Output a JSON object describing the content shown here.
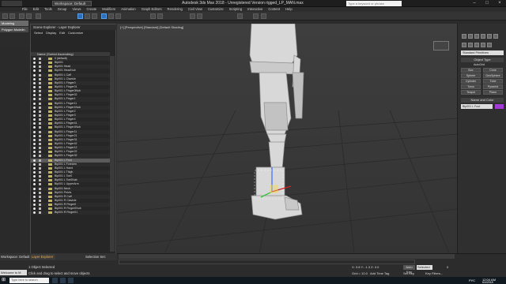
{
  "titlebar": {
    "title": "Autodesk 3ds Max 2018 - Unregistered Version   rigged_LP_MAN.max",
    "workspace_label": "Workspace: Default",
    "search_placeholder": "Type a keyword or phrase"
  },
  "menubar": {
    "items": [
      "File",
      "Edit",
      "Tools",
      "Group",
      "Views",
      "Create",
      "Modifiers",
      "Animation",
      "Graph Editors",
      "Rendering",
      "Civil View",
      "Customize",
      "Scripting",
      "Interactive",
      "Content",
      "Help"
    ]
  },
  "left_ribbon": {
    "tabs": [
      "Modeling",
      "Polygon Modelin"
    ]
  },
  "scene_explorer": {
    "title": "Scene Explorer - Layer Explorer",
    "menu": [
      "Select",
      "Display",
      "Edit",
      "Customize"
    ],
    "column_header": "Name (Sorted Ascending)",
    "rows": [
      "0 (default)",
      "Bip001",
      "Bip001 Head",
      "Bip001 HeadNub",
      "Bip001 L Calf",
      "Bip001 L Clavicle",
      "Bip001 L Finger0",
      "Bip001 L Finger01",
      "Bip001 L Finger0Nub",
      "Bip001 L Finger02",
      "Bip001 L Finger1",
      "Bip001 L Finger11",
      "Bip001 L Finger1Nub",
      "Bip001 L Finger2",
      "Bip001 L Finger3",
      "Bip001 L Finger4",
      "Bip001 L Finger41",
      "Bip001 L Finger4Nub",
      "Bip001 L Finger11",
      "Bip001 L Finger21",
      "Bip001 L Finger31",
      "Bip001 L Finger42",
      "Bip001 L Finger12",
      "Bip001 L Finger22",
      "Bip001 L Finger32",
      "Bip001 L Foot",
      "Bip001 L Forearm",
      "Bip001 L Hand",
      "Bip001 L Thigh",
      "Bip001 L Toe0",
      "Bip001 L Toe0Nub",
      "Bip001 L UpperArm",
      "Bip001 Neck",
      "Bip001 Pelvis",
      "Bip001 R Calf",
      "Bip001 R Clavicle",
      "Bip001 R Finger0",
      "Bip001 R Finger0Nub",
      "Bip001 R Finger01"
    ],
    "selected_index": 25
  },
  "viewport": {
    "label": "[+] [Perspective] [Standard] [Default Shading]"
  },
  "command_panel": {
    "dropdown": "Standard Primitives",
    "rollout_object_type": "Object Type",
    "autogrid": "AutoGrid",
    "buttons": [
      "Box",
      "Cone",
      "Sphere",
      "GeoSphere",
      "Cylinder",
      "Tube",
      "Torus",
      "Pyramid",
      "Teapot",
      "Plane"
    ],
    "rollout_name_color": "Name and Color",
    "name_value": "Bip001 L Foot",
    "swatch_color": "#a23ad4"
  },
  "bottom": {
    "workspace": "Workspace: Default",
    "layer_tab": "Layer Explorer",
    "selection_set": "Selection Set:",
    "status_selected": "1 Object Selected",
    "status_hint": "Click and drag to select and move objects",
    "maxscript": "Welcome to M",
    "coord": "X: 3.8   Y: -1.3   Z: 0.0",
    "grid": "Grid = 10.0",
    "add_time_tag": "Add Time Tag",
    "auto_key": "Auto Key",
    "selected_dd": "Selected",
    "set_key": "Set Key",
    "key_filters": "Key Filters...",
    "frame": "0"
  },
  "taskbar": {
    "search_placeholder": "Type here to search",
    "lang": "РУС",
    "time": "12:04 AM",
    "date": "6/4/2018"
  }
}
